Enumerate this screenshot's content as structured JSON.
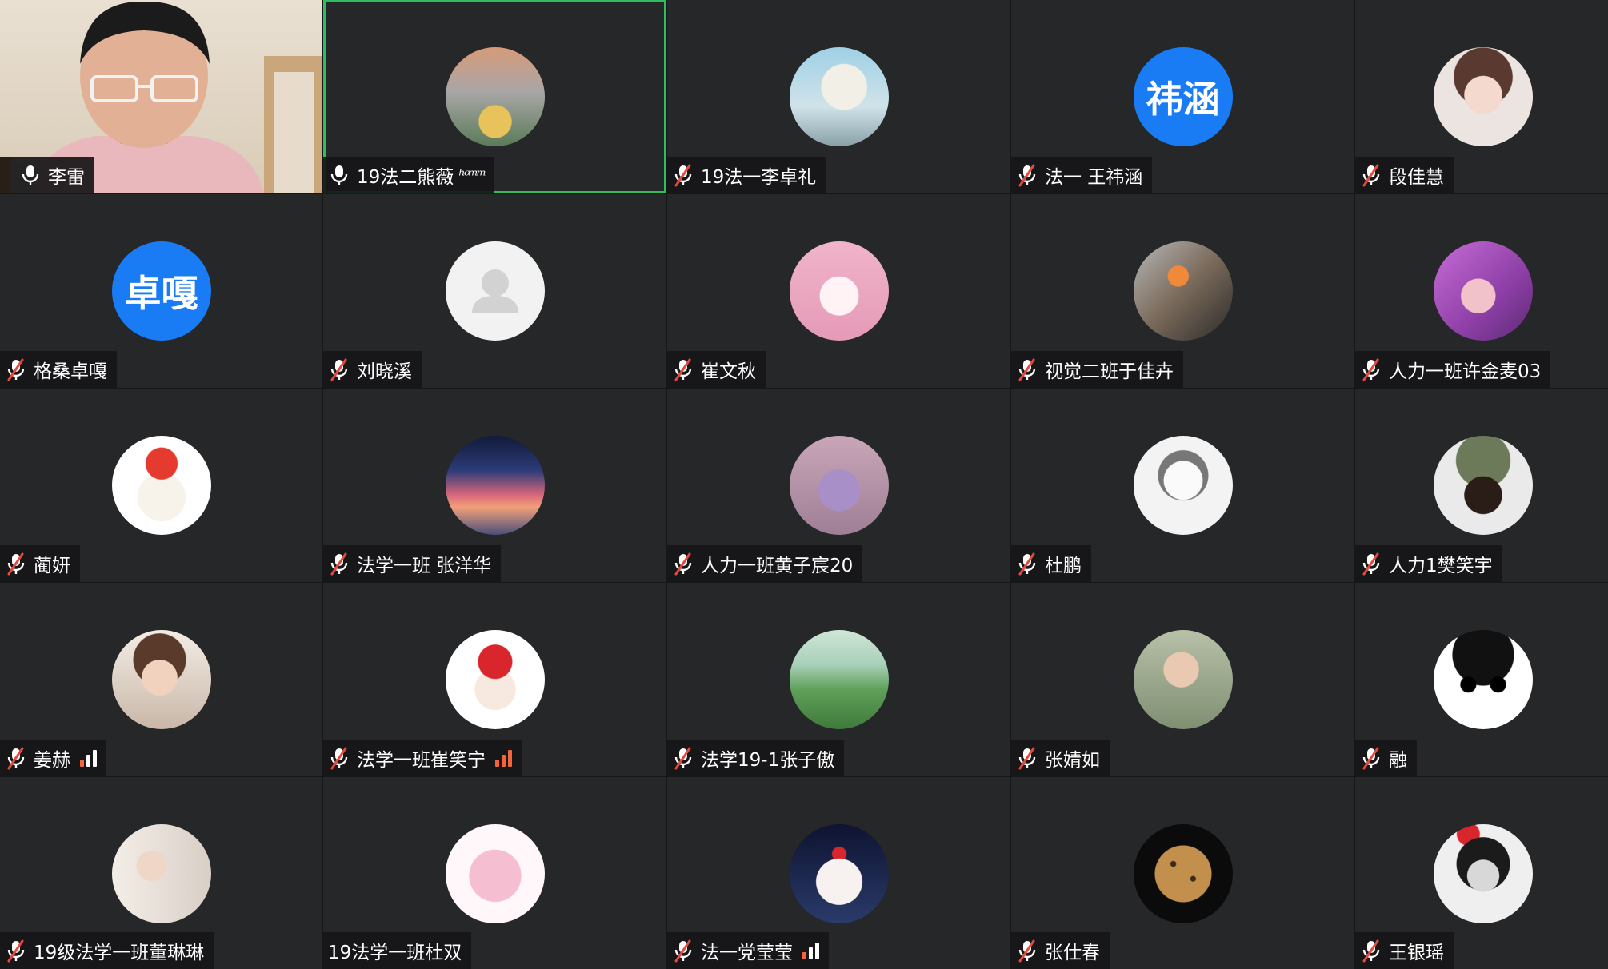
{
  "window": {
    "title": "Video conference gallery view"
  },
  "colors": {
    "active_speaker_outline": "#2ebd5f",
    "tile_bg": "#262729",
    "mic_muted": "#e64a3d",
    "text_avatar_bg": "#1a7cf5",
    "signal_hot": "#f2663a"
  },
  "participants": [
    {
      "name": "李雷",
      "mic": "on",
      "avatar": "camera-video"
    },
    {
      "name": "19法二熊薇 ",
      "mic": "on",
      "active": true,
      "avatar": "photo-child-on-terrace",
      "signature": "手写签名"
    },
    {
      "name": "19法一李卓礼",
      "mic": "muted",
      "avatar": "photo-anime-boy-white-hair"
    },
    {
      "name": "法一 王祎涵",
      "mic": "muted",
      "avatar": "text",
      "avatar_text": "祎涵"
    },
    {
      "name": "段佳慧",
      "mic": "muted",
      "avatar": "photo-girl-portrait"
    },
    {
      "name": "格桑卓嘎",
      "mic": "muted",
      "avatar": "text",
      "avatar_text": "卓嘎"
    },
    {
      "name": "刘晓溪",
      "mic": "muted",
      "avatar": "default-person"
    },
    {
      "name": "崔文秋",
      "mic": "muted",
      "avatar": "photo-pink-plush"
    },
    {
      "name": "视觉二班于佳卉",
      "mic": "muted",
      "avatar": "photo-selfie-orange-glasses"
    },
    {
      "name": "人力一班许金麦03",
      "mic": "muted",
      "avatar": "photo-anime-purple-hair"
    },
    {
      "name": "蔺妍",
      "mic": "muted",
      "avatar": "photo-fox-flower"
    },
    {
      "name": "法学一班 张洋华",
      "mic": "muted",
      "avatar": "photo-sunset-sky"
    },
    {
      "name": "人力一班黄子宸20",
      "mic": "muted",
      "avatar": "photo-purple-bear"
    },
    {
      "name": "杜鹏",
      "mic": "muted",
      "avatar": "photo-sketch-girl"
    },
    {
      "name": "人力1樊笑宇",
      "mic": "muted",
      "avatar": "photo-soldier-sunglasses"
    },
    {
      "name": "姜赫",
      "mic": "muted",
      "avatar": "photo-young-man",
      "signal": "mixed"
    },
    {
      "name": "法学一班崔笑宁",
      "mic": "muted",
      "avatar": "photo-anime-santa-girl",
      "signal": "strong"
    },
    {
      "name": "法学19-1张子傲",
      "mic": "muted",
      "avatar": "photo-green-field"
    },
    {
      "name": "张婧如",
      "mic": "muted",
      "avatar": "photo-girl-reading"
    },
    {
      "name": "融",
      "mic": "muted",
      "avatar": "photo-cartoon-face"
    },
    {
      "name": "19级法学一班董琳琳",
      "mic": "muted",
      "avatar": "photo-girl-santa-hat"
    },
    {
      "name": "19法学一班杜双",
      "mic": "none",
      "avatar": "photo-pink-blob"
    },
    {
      "name": "法一党莹莹",
      "mic": "muted",
      "avatar": "photo-white-cat",
      "signal": "mixed"
    },
    {
      "name": "张仕春",
      "mic": "muted",
      "avatar": "photo-leopard"
    },
    {
      "name": "王银瑶",
      "mic": "muted",
      "avatar": "photo-girl-bw-santa"
    }
  ]
}
